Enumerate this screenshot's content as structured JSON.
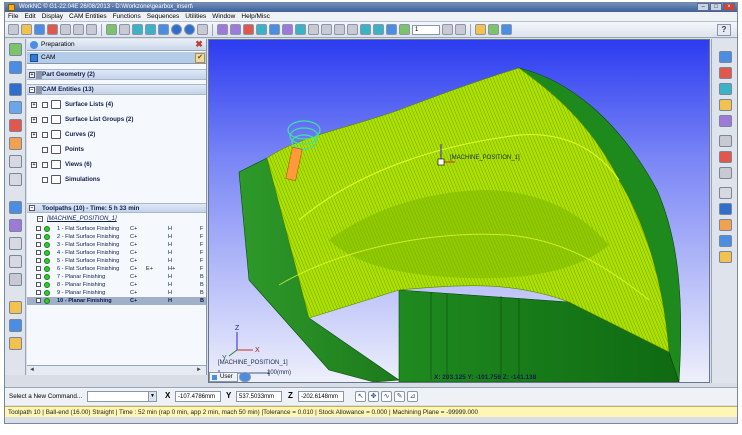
{
  "window": {
    "title": "WorkNC  ©  G1-22.04E     26/08/2013  -  D:\\Workzone\\gearbox_insert\\"
  },
  "menubar": {
    "items": [
      "File",
      "Edit",
      "Display",
      "CAM Entities",
      "Functions",
      "Sequences",
      "Utilities",
      "Window",
      "Help/Misc"
    ]
  },
  "toolbar": {
    "zoom_value": "1"
  },
  "panel": {
    "header": "Preparation",
    "cam_label": "CAM",
    "part_geometry": "Part Geometry (2)",
    "cam_entities": "CAM Entities (13)",
    "entities": [
      {
        "label": "Surface Lists (4)"
      },
      {
        "label": "Surface List Groups (2)"
      },
      {
        "label": "Curves (2)"
      },
      {
        "label": "Points"
      },
      {
        "label": "Views (6)"
      },
      {
        "label": "Simulations"
      }
    ],
    "toolpaths_header": "Toolpaths (10)  -  Time: 5 h 33 min",
    "machine_position": "[MACHINE_POSITION_1]",
    "toolpaths": [
      {
        "name": "1 - Flat Surface Finishing",
        "c1": "C+",
        "c2": "",
        "c3": "H",
        "c4": "F"
      },
      {
        "name": "2 - Flat Surface Finishing",
        "c1": "C+",
        "c2": "",
        "c3": "H",
        "c4": "F"
      },
      {
        "name": "3 - Flat Surface Finishing",
        "c1": "C+",
        "c2": "",
        "c3": "H",
        "c4": "F"
      },
      {
        "name": "4 - Flat Surface Finishing",
        "c1": "C+",
        "c2": "",
        "c3": "H",
        "c4": "F"
      },
      {
        "name": "5 - Flat Surface Finishing",
        "c1": "C+",
        "c2": "",
        "c3": "H",
        "c4": "F"
      },
      {
        "name": "6 - Flat Surface Finishing",
        "c1": "C+",
        "c2": "E+",
        "c3": "H+",
        "c4": "F"
      },
      {
        "name": "7 - Planar Finishing",
        "c1": "C+",
        "c2": "",
        "c3": "H",
        "c4": "B"
      },
      {
        "name": "8 - Planar Finishing",
        "c1": "C+",
        "c2": "",
        "c3": "H",
        "c4": "B"
      },
      {
        "name": "9 - Planar Finishing",
        "c1": "C+",
        "c2": "",
        "c3": "H",
        "c4": "B"
      },
      {
        "name": "10 - Planar Finishing",
        "c1": "C+",
        "c2": "",
        "c3": "H",
        "c4": "B"
      }
    ]
  },
  "viewport": {
    "machine_label_main": "[MACHINE_POSITION_1]",
    "machine_label_small": "[MACHINE_POSITION_1]",
    "scale_label": "100(mm)",
    "tab_user": "User",
    "coord_readout": "X: 203.125   Y: -101.756   Z: -141.138",
    "axis_x": "X",
    "axis_y": "Y",
    "axis_z": "Z"
  },
  "command_bar": {
    "label": "Select a New Command...",
    "x_label": "X",
    "x_value": "-107.4786mm",
    "y_label": "Y",
    "y_value": "537.5033mm",
    "z_label": "Z",
    "z_value": "-202.6148mm"
  },
  "status": {
    "text": "Toolpath 10 | Ball-end (16.00) Straight | Time : 52 min (rap 0 min, app 2 min, mach 50 min) |Tolerance = 0.010 | Stock Allowance = 0.000 | Machining Plane = -99999.000"
  },
  "colors": {
    "viewport_top": "#2c3cf0",
    "part_green": "#1c8a1c",
    "toolpath_yellow": "#c8f000",
    "status_bg": "#fdf6b4"
  }
}
